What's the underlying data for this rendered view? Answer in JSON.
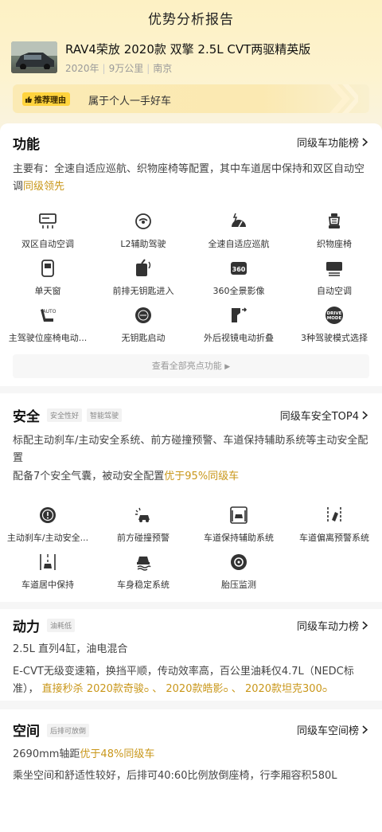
{
  "header": {
    "title": "优势分析报告"
  },
  "car": {
    "name": "RAV4荣放 2020款 双擎 2.5L CVT两驱精英版",
    "year": "2020年",
    "mileage": "9万公里",
    "city": "南京"
  },
  "reason": {
    "badge": "推荐理由",
    "text": "属于个人一手好车"
  },
  "function": {
    "title": "功能",
    "link": "同级车功能榜",
    "summary": "主要有：全速自适应巡航、织物座椅等配置，其中车道居中保持和双区自动空调",
    "summary_hl": "同级领先",
    "items": [
      {
        "label": "双区自动空调",
        "icon": "dual-zone-ac-icon"
      },
      {
        "label": "L2辅助驾驶",
        "icon": "l2-assist-icon"
      },
      {
        "label": "全速自适应巡航",
        "icon": "adaptive-cruise-icon"
      },
      {
        "label": "织物座椅",
        "icon": "fabric-seat-icon"
      },
      {
        "label": "单天窗",
        "icon": "sunroof-icon"
      },
      {
        "label": "前排无钥匙进入",
        "icon": "keyless-entry-icon"
      },
      {
        "label": "360全景影像",
        "icon": "camera-360-icon"
      },
      {
        "label": "自动空调",
        "icon": "auto-ac-icon"
      },
      {
        "label": "主驾驶位座椅电动...",
        "icon": "power-seat-icon"
      },
      {
        "label": "无钥匙启动",
        "icon": "keyless-start-icon"
      },
      {
        "label": "外后视镜电动折叠",
        "icon": "mirror-fold-icon"
      },
      {
        "label": "3种驾驶模式选择",
        "icon": "drive-mode-icon"
      }
    ],
    "more": "查看全部亮点功能"
  },
  "safety": {
    "title": "安全",
    "tags": [
      "安全性好",
      "智能驾驶"
    ],
    "link": "同级车安全TOP4",
    "line1": "标配主动刹车/主动安全系统、前方碰撞预警、车道保持辅助系统等主动安全配置",
    "line2_pre": "配备7个安全气囊，被动安全配置",
    "line2_hl": "优于95%同级车",
    "items": [
      {
        "label": "主动刹车/主动安全...",
        "icon": "auto-brake-icon"
      },
      {
        "label": "前方碰撞预警",
        "icon": "collision-warning-icon"
      },
      {
        "label": "车道保持辅助系统",
        "icon": "lane-keep-icon"
      },
      {
        "label": "车道偏离预警系统",
        "icon": "lane-departure-icon"
      },
      {
        "label": "车道居中保持",
        "icon": "lane-center-icon"
      },
      {
        "label": "车身稳定系统",
        "icon": "stability-icon"
      },
      {
        "label": "胎压监测",
        "icon": "tire-pressure-icon"
      }
    ]
  },
  "power": {
    "title": "动力",
    "tag": "油耗低",
    "link": "同级车动力榜",
    "line1": "2.5L 直列4缸，油电混合",
    "line2": "E-CVT无级变速箱，换挡平顺，传动效率高，百公里油耗仅4.7L（NEDC标准），",
    "line2_hl": "直接秒杀",
    "rivals": [
      "2020款奇骏",
      "2020款皓影",
      "2020款坦克300"
    ]
  },
  "space": {
    "title": "空间",
    "tag": "后排可放倒",
    "link": "同级车空间榜",
    "line1_pre": "2690mm轴距",
    "line1_hl": "优于48%同级车",
    "line2": "乘坐空间和舒适性较好，后排可40:60比例放倒座椅，行李厢容积580L"
  },
  "colors": {
    "accent": "#c9971a",
    "badge": "#ffd33d"
  }
}
